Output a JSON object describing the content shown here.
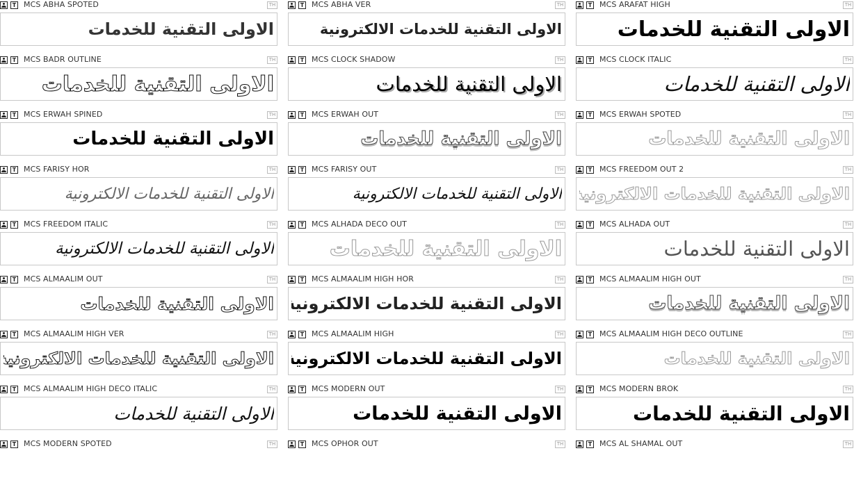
{
  "badge_th": "TH",
  "icon_type_glyph": "T",
  "fonts": [
    {
      "name": "MCS ABHA SPOTED",
      "sample": "الاولى التقنية للخدمات",
      "style": "s-dotted",
      "size": 24
    },
    {
      "name": "MCS ABHA VER",
      "sample": "الاولى التقنية للخدمات الالكترونية",
      "style": "s-stripe",
      "size": 21
    },
    {
      "name": "MCS ARAFAT HIGH",
      "sample": "الاولى التقنية للخدمات",
      "style": "s-solid",
      "size": 30
    },
    {
      "name": "MCS BADR OUTLINE",
      "sample": "الاولى التقنية للخدمات",
      "style": "s-outline",
      "size": 30
    },
    {
      "name": "MCS CLOCK SHADOW",
      "sample": "الاولى التقنية للخدمات",
      "style": "s-shadow",
      "size": 29
    },
    {
      "name": "MCS CLOCK ITALIC",
      "sample": "الاولى التقنية للخدمات",
      "style": "s-italic",
      "size": 29
    },
    {
      "name": "MCS ERWAH SPINED",
      "sample": "الاولى التقنية للخدمات",
      "style": "s-solid",
      "size": 26
    },
    {
      "name": "MCS ERWAH OUT",
      "sample": "الاولى التقنية للخدمات",
      "style": "s-deco",
      "size": 26
    },
    {
      "name": "MCS ERWAH SPOTED",
      "sample": "الاولى التقنية للخدمات",
      "style": "s-outline-light",
      "size": 26
    },
    {
      "name": "MCS FARISY HOR",
      "sample": "الاولى التقنية للخدمات الالكترونية",
      "style": "s-italic-light",
      "size": 22
    },
    {
      "name": "MCS FARISY OUT",
      "sample": "الاولى التقنية للخدمات الالكترونية",
      "style": "s-italic",
      "size": 22
    },
    {
      "name": "MCS FREEDOM OUT 2",
      "sample": "الاولى التقنية للخدمات الالكترونية",
      "style": "s-outline-light",
      "size": 24
    },
    {
      "name": "MCS FREEDOM ITALIC",
      "sample": "الاولى التقنية للخدمات الالكترونية",
      "style": "s-italic",
      "size": 23
    },
    {
      "name": "MCS ALHADA DECO OUT",
      "sample": "الاولى التقنية للخدمات",
      "style": "s-outline-light",
      "size": 30
    },
    {
      "name": "MCS ALHADA OUT",
      "sample": "الاولى التقنية للخدمات",
      "style": "s-light",
      "size": 29
    },
    {
      "name": "MCS ALMAALIM OUT",
      "sample": "الاولى التقنية للخدمات",
      "style": "s-outline",
      "size": 25
    },
    {
      "name": "MCS ALMAALIM HIGH HOR",
      "sample": "الاولى التقنية للخدمات الالكترونية",
      "style": "s-stripe",
      "size": 24
    },
    {
      "name": "MCS ALMAALIM HIGH OUT",
      "sample": "الاولى التقنية للخدمات",
      "style": "s-deco",
      "size": 26
    },
    {
      "name": "MCS ALMAALIM HIGH VER",
      "sample": "الاولى التقنية للخدمات الالكترونية",
      "style": "s-outline",
      "size": 24
    },
    {
      "name": "MCS ALMAALIM HIGH",
      "sample": "الاولى التقنية للخدمات الالكترونية",
      "style": "s-solid",
      "size": 24
    },
    {
      "name": "MCS ALMAALIM HIGH DECO OUTLINE",
      "sample": "الاولى التقنية للخدمات",
      "style": "s-outline-light",
      "size": 24
    },
    {
      "name": "MCS ALMAALIM HIGH DECO ITALIC",
      "sample": "الاولى التقنية للخدمات",
      "style": "s-italic",
      "size": 25
    },
    {
      "name": "MCS MODERN OUT",
      "sample": "الاولى التقنية للخدمات",
      "style": "s-solid",
      "size": 27
    },
    {
      "name": "MCS MODERN BROK",
      "sample": "الاولى التقنية للخدمات",
      "style": "s-broken",
      "size": 28
    },
    {
      "name": "MCS MODERN SPOTED",
      "sample": "",
      "style": "s-solid",
      "size": 26
    },
    {
      "name": "MCS OPHOR OUT",
      "sample": "",
      "style": "s-solid",
      "size": 26
    },
    {
      "name": "MCS AL SHAMAL OUT",
      "sample": "",
      "style": "s-solid",
      "size": 26
    }
  ]
}
